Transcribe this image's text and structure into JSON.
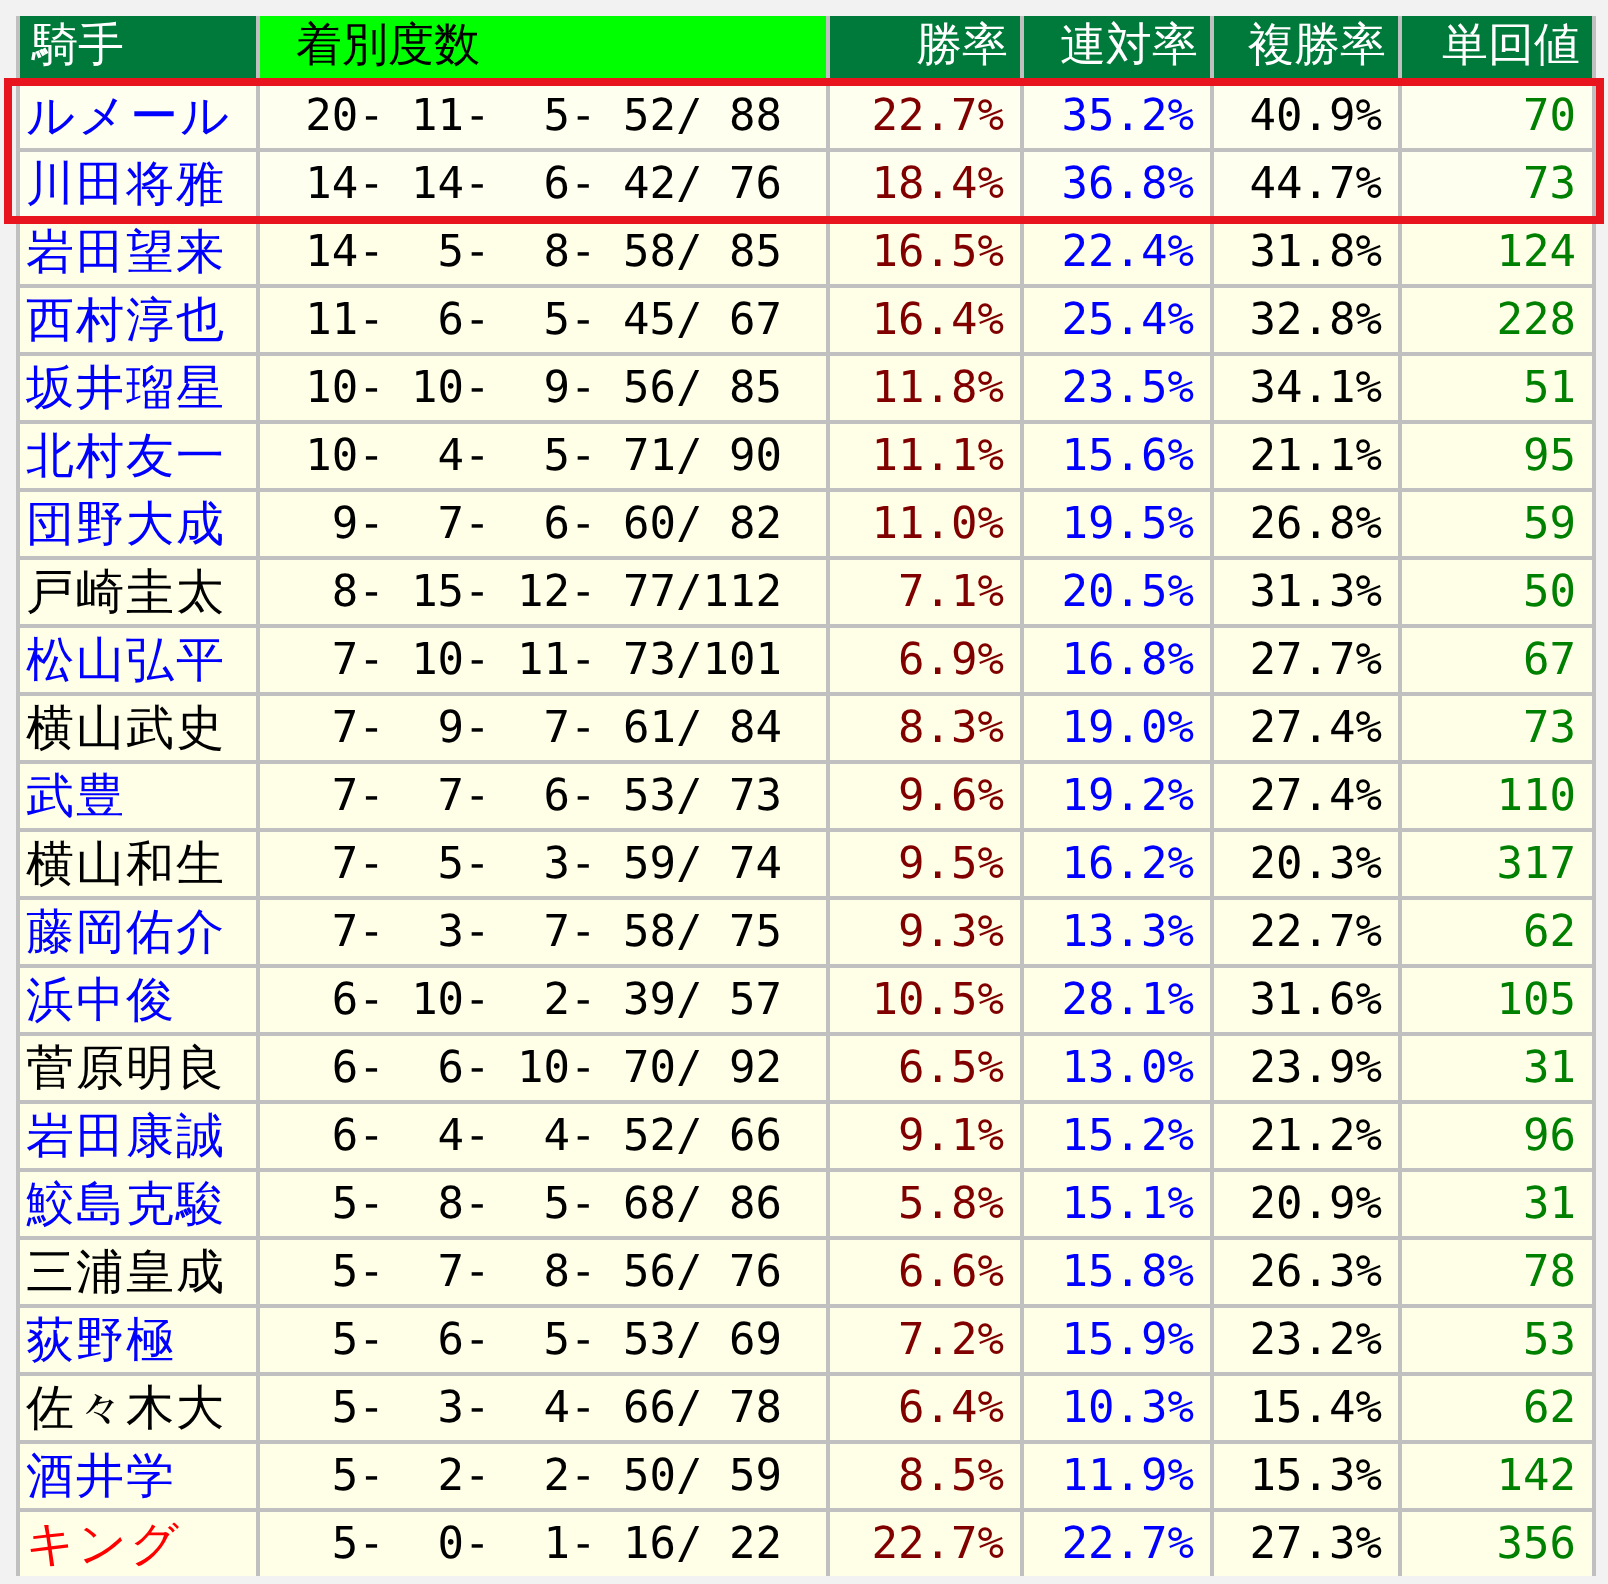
{
  "table": {
    "columns": [
      {
        "label": "騎手",
        "kind": "name"
      },
      {
        "label": "着別度数",
        "kind": "record"
      },
      {
        "label": "勝率",
        "kind": "win"
      },
      {
        "label": "連対率",
        "kind": "place"
      },
      {
        "label": "複勝率",
        "kind": "show"
      },
      {
        "label": "単回値",
        "kind": "return"
      }
    ],
    "rows": [
      {
        "cells": [
          "ルメール",
          "20- 11-  5- 52/ 88",
          "22.7%",
          "35.2%",
          "40.9%",
          "70"
        ],
        "color": "#0000ff",
        "highlighted": true
      },
      {
        "cells": [
          "川田将雅",
          "14- 14-  6- 42/ 76",
          "18.4%",
          "36.8%",
          "44.7%",
          "73"
        ],
        "color": "#0000ff",
        "highlighted": true
      },
      {
        "cells": [
          "岩田望来",
          "14-  5-  8- 58/ 85",
          "16.5%",
          "22.4%",
          "31.8%",
          "124"
        ],
        "color": "#0000ff",
        "highlighted": false
      },
      {
        "cells": [
          "西村淳也",
          "11-  6-  5- 45/ 67",
          "16.4%",
          "25.4%",
          "32.8%",
          "228"
        ],
        "color": "#0000ff",
        "highlighted": false
      },
      {
        "cells": [
          "坂井瑠星",
          "10- 10-  9- 56/ 85",
          "11.8%",
          "23.5%",
          "34.1%",
          "51"
        ],
        "color": "#0000ff",
        "highlighted": false
      },
      {
        "cells": [
          "北村友一",
          "10-  4-  5- 71/ 90",
          "11.1%",
          "15.6%",
          "21.1%",
          "95"
        ],
        "color": "#0000ff",
        "highlighted": false
      },
      {
        "cells": [
          "団野大成",
          "9-  7-  6- 60/ 82",
          "11.0%",
          "19.5%",
          "26.8%",
          "59"
        ],
        "color": "#0000ff",
        "highlighted": false
      },
      {
        "cells": [
          "戸崎圭太",
          "8- 15- 12- 77/112",
          "7.1%",
          "20.5%",
          "31.3%",
          "50"
        ],
        "color": "#000000",
        "highlighted": false
      },
      {
        "cells": [
          "松山弘平",
          "7- 10- 11- 73/101",
          "6.9%",
          "16.8%",
          "27.7%",
          "67"
        ],
        "color": "#0000ff",
        "highlighted": false
      },
      {
        "cells": [
          "横山武史",
          "7-  9-  7- 61/ 84",
          "8.3%",
          "19.0%",
          "27.4%",
          "73"
        ],
        "color": "#000000",
        "highlighted": false
      },
      {
        "cells": [
          "武豊",
          "7-  7-  6- 53/ 73",
          "9.6%",
          "19.2%",
          "27.4%",
          "110"
        ],
        "color": "#0000ff",
        "highlighted": false
      },
      {
        "cells": [
          "横山和生",
          "7-  5-  3- 59/ 74",
          "9.5%",
          "16.2%",
          "20.3%",
          "317"
        ],
        "color": "#000000",
        "highlighted": false
      },
      {
        "cells": [
          "藤岡佑介",
          "7-  3-  7- 58/ 75",
          "9.3%",
          "13.3%",
          "22.7%",
          "62"
        ],
        "color": "#0000ff",
        "highlighted": false
      },
      {
        "cells": [
          "浜中俊",
          "6- 10-  2- 39/ 57",
          "10.5%",
          "28.1%",
          "31.6%",
          "105"
        ],
        "color": "#0000ff",
        "highlighted": false
      },
      {
        "cells": [
          "菅原明良",
          "6-  6- 10- 70/ 92",
          "6.5%",
          "13.0%",
          "23.9%",
          "31"
        ],
        "color": "#000000",
        "highlighted": false
      },
      {
        "cells": [
          "岩田康誠",
          "6-  4-  4- 52/ 66",
          "9.1%",
          "15.2%",
          "21.2%",
          "96"
        ],
        "color": "#0000ff",
        "highlighted": false
      },
      {
        "cells": [
          "鮫島克駿",
          "5-  8-  5- 68/ 86",
          "5.8%",
          "15.1%",
          "20.9%",
          "31"
        ],
        "color": "#0000ff",
        "highlighted": false
      },
      {
        "cells": [
          "三浦皇成",
          "5-  7-  8- 56/ 76",
          "6.6%",
          "15.8%",
          "26.3%",
          "78"
        ],
        "color": "#000000",
        "highlighted": false
      },
      {
        "cells": [
          "荻野極",
          "5-  6-  5- 53/ 69",
          "7.2%",
          "15.9%",
          "23.2%",
          "53"
        ],
        "color": "#0000ff",
        "highlighted": false
      },
      {
        "cells": [
          "佐々木大",
          "5-  3-  4- 66/ 78",
          "6.4%",
          "10.3%",
          "15.4%",
          "62"
        ],
        "color": "#000000",
        "highlighted": false
      },
      {
        "cells": [
          "酒井学",
          "5-  2-  2- 50/ 59",
          "8.5%",
          "11.9%",
          "15.3%",
          "142"
        ],
        "color": "#0000ff",
        "highlighted": false
      },
      {
        "cells": [
          "キング",
          "5-  0-  1- 16/ 22",
          "22.7%",
          "22.7%",
          "27.3%",
          "356"
        ],
        "color": "#ff0000",
        "highlighted": false
      }
    ]
  }
}
